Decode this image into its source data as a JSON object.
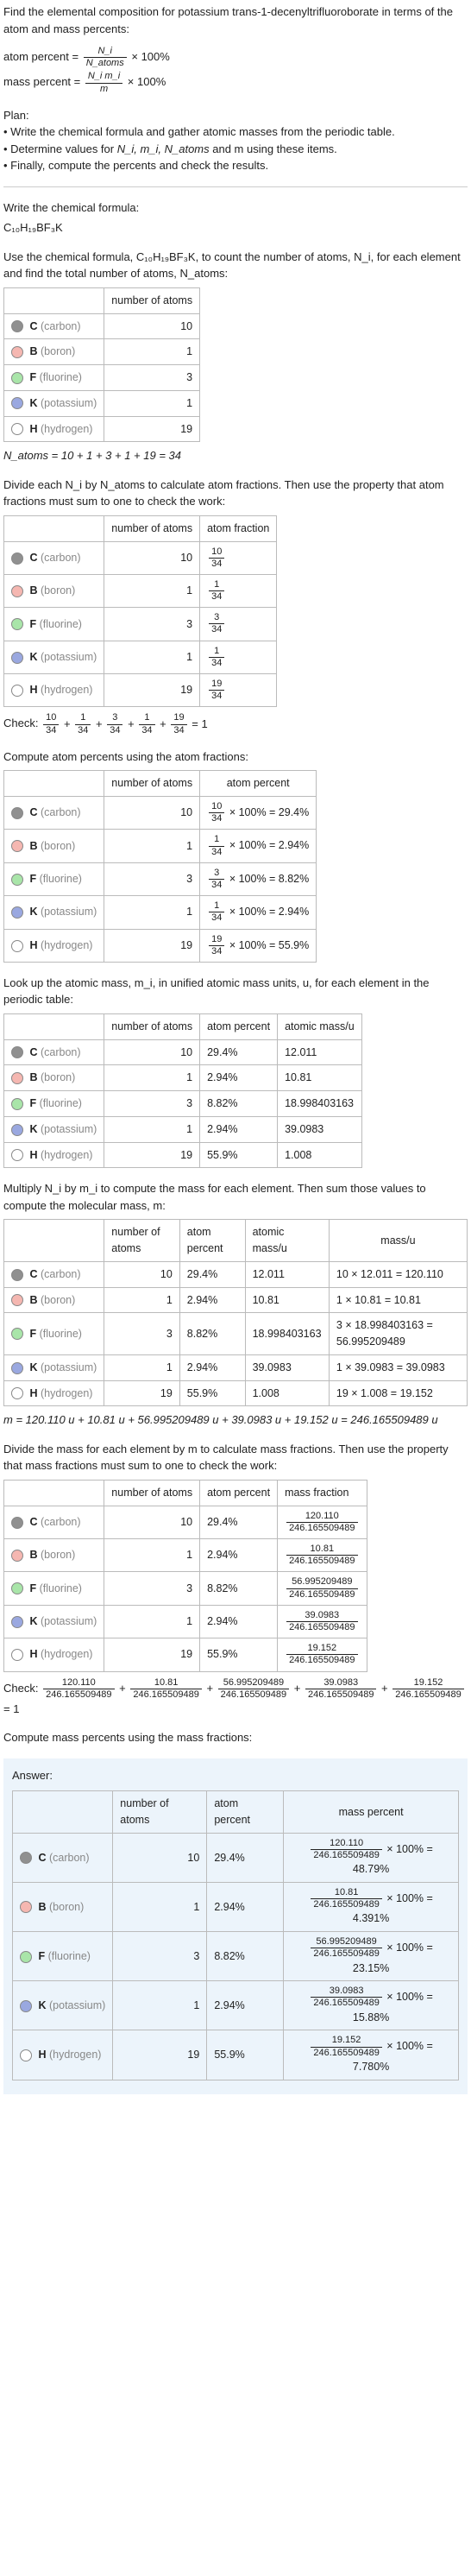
{
  "intro": {
    "prompt": "Find the elemental composition for potassium trans-1-decenyltrifluoroborate in terms of the atom and mass percents:",
    "atom_percent_label": "atom percent =",
    "atom_percent_frac_num": "N_i",
    "atom_percent_frac_den": "N_atoms",
    "times_100": "× 100%",
    "mass_percent_label": "mass percent =",
    "mass_percent_frac_num": "N_i m_i",
    "mass_percent_frac_den": "m"
  },
  "plan": {
    "heading": "Plan:",
    "line1": "• Write the chemical formula and gather atomic masses from the periodic table.",
    "line2_a": "• Determine values for ",
    "line2_vars": "N_i, m_i, N_atoms",
    "line2_b": " and m using these items.",
    "line3": "• Finally, compute the percents and check the results."
  },
  "write_formula": {
    "heading": "Write the chemical formula:",
    "formula": "C₁₀H₁₉BF₃K"
  },
  "count_atoms": {
    "heading_a": "Use the chemical formula, ",
    "heading_formula": "C₁₀H₁₉BF₃K",
    "heading_b": ", to count the number of atoms, N_i, for each element and find the total number of atoms, N_atoms:"
  },
  "elements": [
    {
      "key": "carbon",
      "sym": "C",
      "name": "(carbon)",
      "swatch": "carbon",
      "n": 10,
      "atom_frac": "10/34",
      "atom_pct_expr": "10/34 × 100% = 29.4%",
      "atom_pct": "29.4%",
      "mass_u": "12.011",
      "mu_expr": "10 × 12.011 = 120.110",
      "mass_frac": "120.110/246.165509489",
      "mass_pct_expr": "120.110/246.165509489 × 100% = 48.79%"
    },
    {
      "key": "boron",
      "sym": "B",
      "name": "(boron)",
      "swatch": "boron",
      "n": 1,
      "atom_frac": "1/34",
      "atom_pct_expr": "1/34 × 100% = 2.94%",
      "atom_pct": "2.94%",
      "mass_u": "10.81",
      "mu_expr": "1 × 10.81 = 10.81",
      "mass_frac": "10.81/246.165509489",
      "mass_pct_expr": "10.81/246.165509489 × 100% = 4.391%"
    },
    {
      "key": "fluorine",
      "sym": "F",
      "name": "(fluorine)",
      "swatch": "fluorine",
      "n": 3,
      "atom_frac": "3/34",
      "atom_pct_expr": "3/34 × 100% = 8.82%",
      "atom_pct": "8.82%",
      "mass_u": "18.998403163",
      "mu_expr": "3 × 18.998403163 = 56.995209489",
      "mass_frac": "56.995209489/246.165509489",
      "mass_pct_expr": "56.995209489/246.165509489 × 100% = 23.15%"
    },
    {
      "key": "potassium",
      "sym": "K",
      "name": "(potassium)",
      "swatch": "potassium",
      "n": 1,
      "atom_frac": "1/34",
      "atom_pct_expr": "1/34 × 100% = 2.94%",
      "atom_pct": "2.94%",
      "mass_u": "39.0983",
      "mu_expr": "1 × 39.0983 = 39.0983",
      "mass_frac": "39.0983/246.165509489",
      "mass_pct_expr": "39.0983/246.165509489 × 100% = 15.88%"
    },
    {
      "key": "hydrogen",
      "sym": "H",
      "name": "(hydrogen)",
      "swatch": "hydrogen",
      "n": 19,
      "atom_frac": "19/34",
      "atom_pct_expr": "19/34 × 100% = 55.9%",
      "atom_pct": "55.9%",
      "mass_u": "1.008",
      "mu_expr": "19 × 1.008 = 19.152",
      "mass_frac": "19.152/246.165509489",
      "mass_pct_expr": "19.152/246.165509489 × 100% = 7.780%"
    }
  ],
  "headers": {
    "number_of_atoms": "number of atoms",
    "atom_fraction": "atom fraction",
    "atom_percent": "atom percent",
    "atomic_mass": "atomic mass/u",
    "mass_u": "mass/u",
    "mass_fraction": "mass fraction",
    "mass_percent": "mass percent"
  },
  "natoms_sum": "N_atoms = 10 + 1 + 3 + 1 + 19 = 34",
  "divide_each": "Divide each N_i by N_atoms to calculate atom fractions. Then use the property that atom fractions must sum to one to check the work:",
  "check_atom_frac": {
    "label": "Check: ",
    "expr": "10/34 + 1/34 + 3/34 + 1/34 + 19/34 = 1"
  },
  "compute_atom_pct": "Compute atom percents using the atom fractions:",
  "lookup_mass": "Look up the atomic mass, m_i, in unified atomic mass units, u, for each element in the periodic table:",
  "multiply_mass": "Multiply N_i by m_i to compute the mass for each element. Then sum those values to compute the molecular mass, m:",
  "m_sum": "m = 120.110 u + 10.81 u + 56.995209489 u + 39.0983 u + 19.152 u = 246.165509489 u",
  "divide_mass": "Divide the mass for each element by m to calculate mass fractions. Then use the property that mass fractions must sum to one to check the work:",
  "check_mass_frac": {
    "label": "Check: ",
    "expr_parts": [
      "120.110",
      "10.81",
      "56.995209489",
      "39.0983",
      "19.152"
    ],
    "den": "246.165509489",
    "eq": " = 1"
  },
  "compute_mass_pct": "Compute mass percents using the mass fractions:",
  "answer_label": "Answer:"
}
